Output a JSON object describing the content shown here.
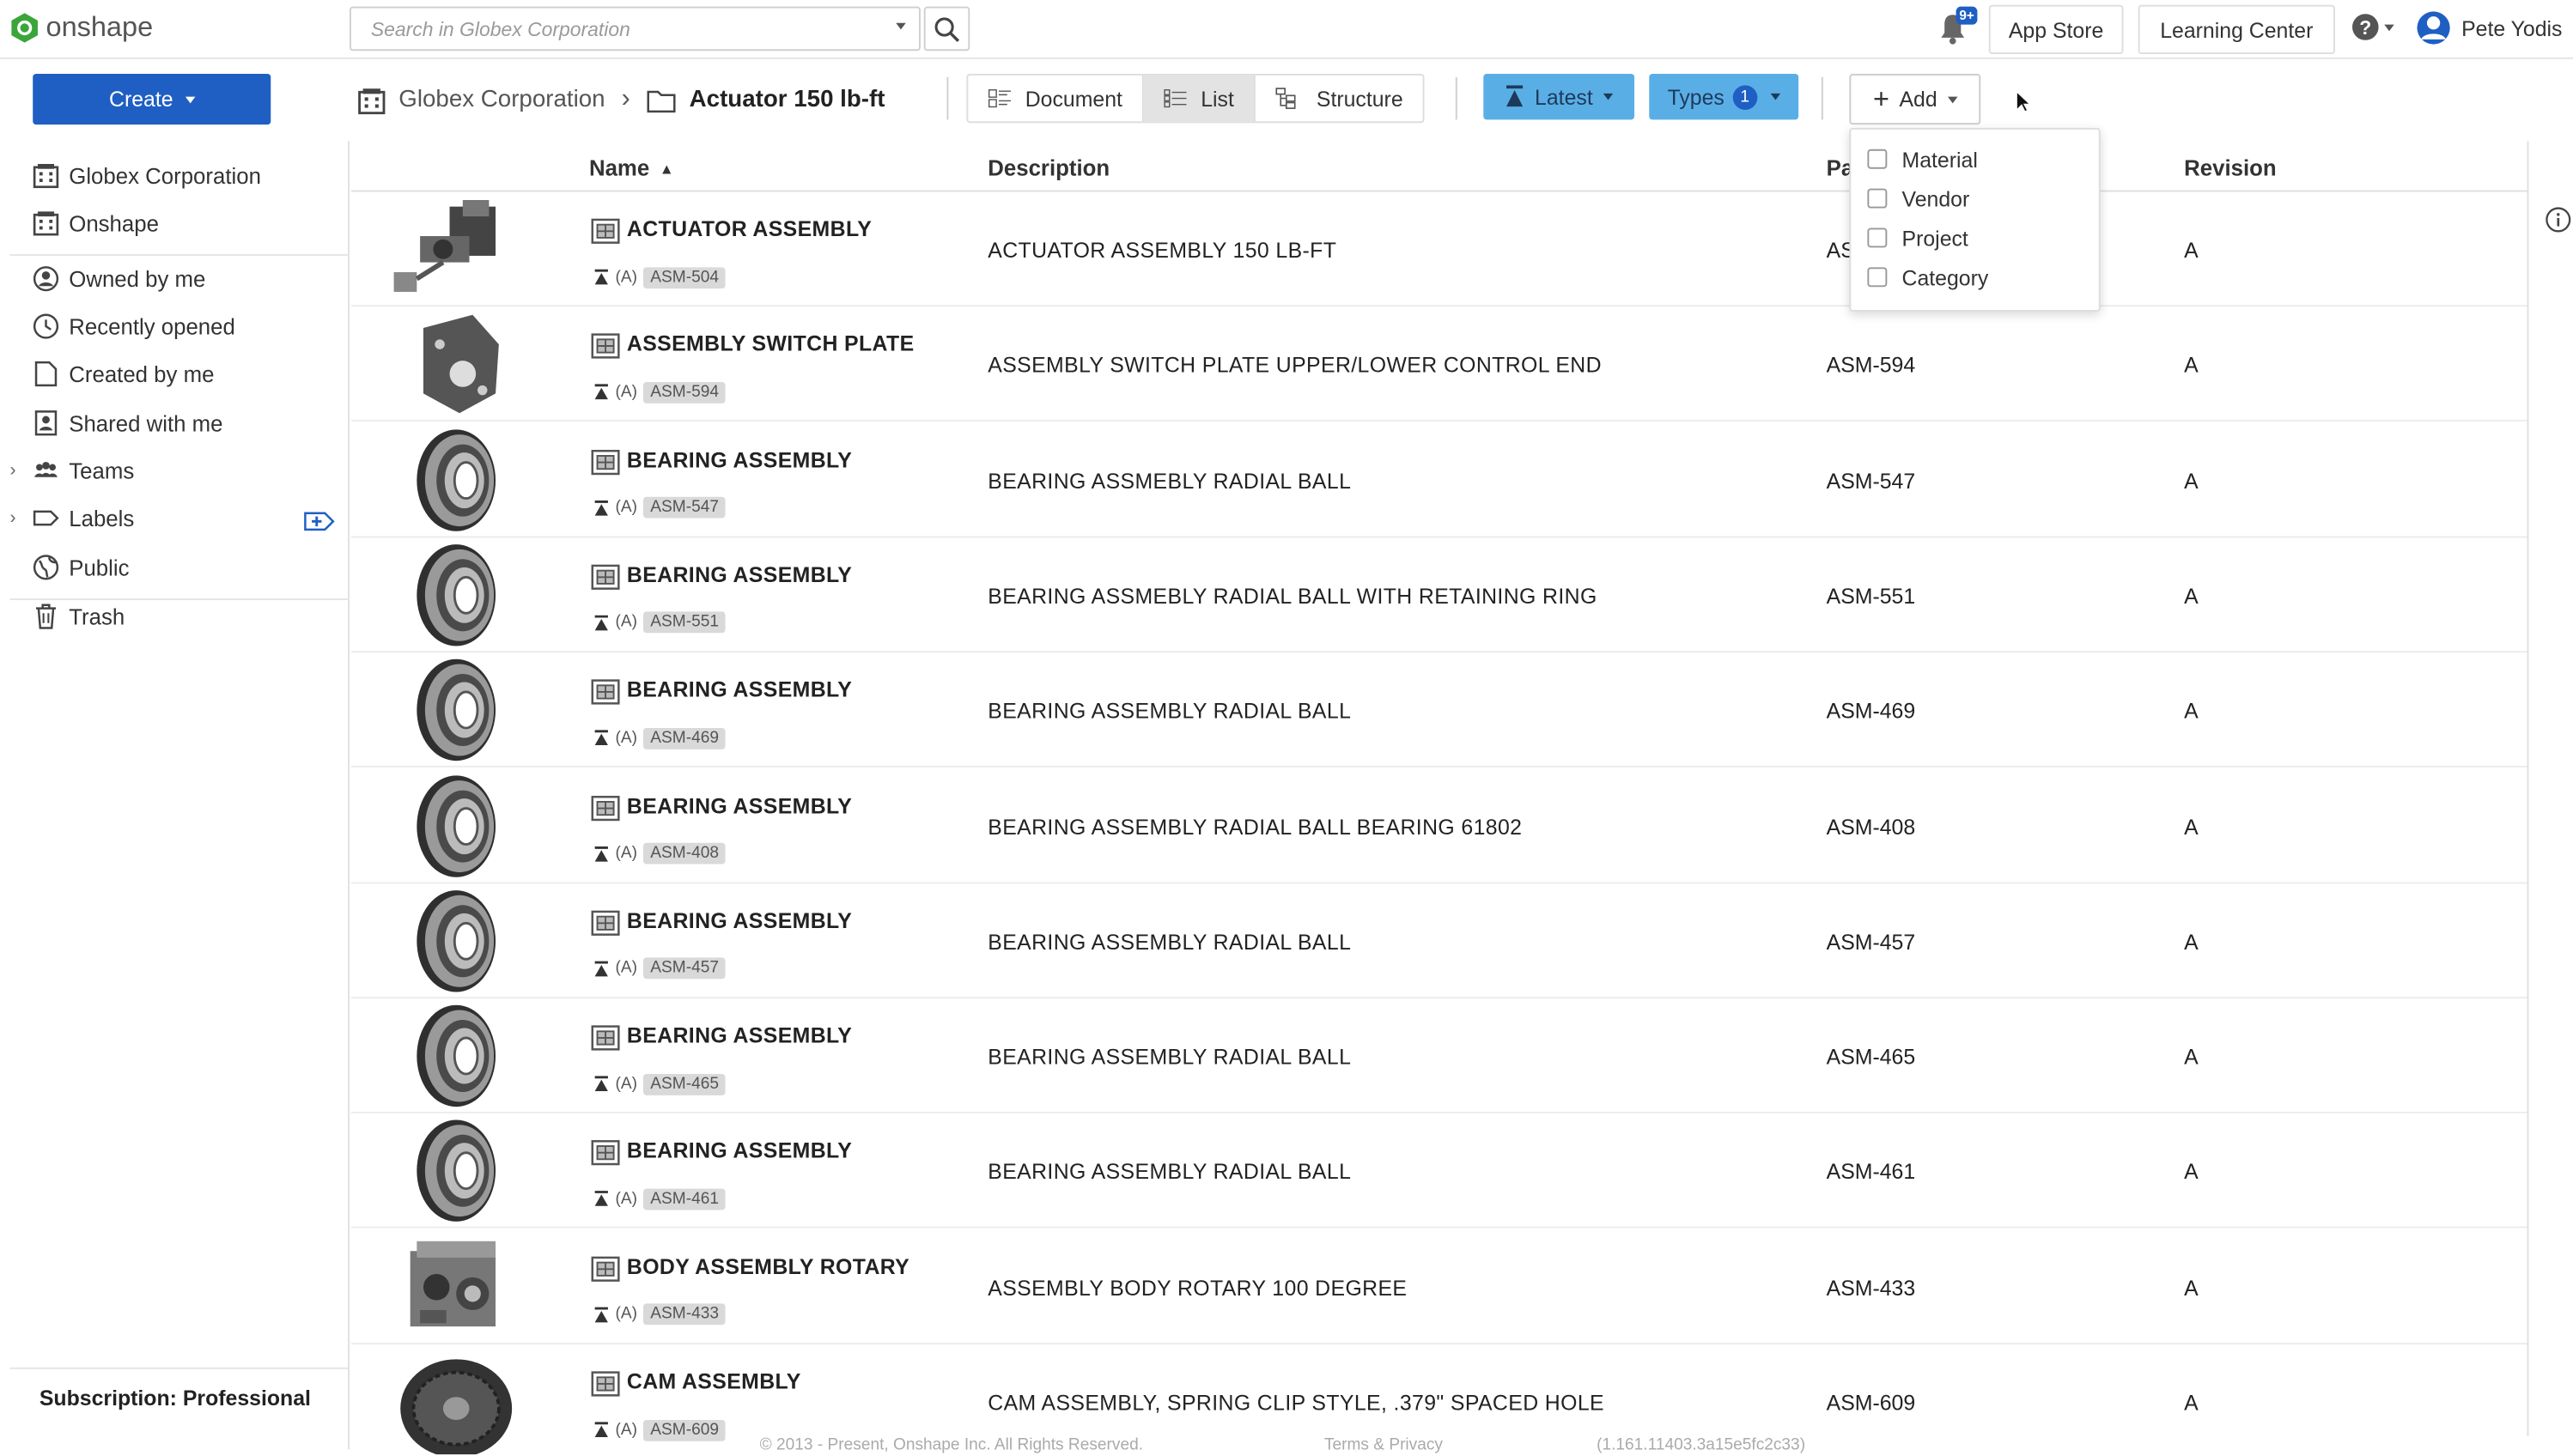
{
  "app": {
    "name": "onshape"
  },
  "search": {
    "placeholder": "Search in Globex Corporation"
  },
  "notifications": {
    "badge": "9+"
  },
  "top": {
    "app_store": "App Store",
    "learning_center": "Learning Center",
    "user": "Pete Yodis"
  },
  "create": {
    "label": "Create"
  },
  "sidebar": {
    "items": [
      {
        "label": "Globex Corporation",
        "icon": "building-icon"
      },
      {
        "label": "Onshape",
        "icon": "building-icon"
      },
      {
        "label": "Owned by me",
        "icon": "person-icon"
      },
      {
        "label": "Recently opened",
        "icon": "clock-icon"
      },
      {
        "label": "Created by me",
        "icon": "document-icon"
      },
      {
        "label": "Shared with me",
        "icon": "shared-icon"
      },
      {
        "label": "Teams",
        "icon": "team-icon"
      },
      {
        "label": "Labels",
        "icon": "label-icon"
      },
      {
        "label": "Public",
        "icon": "globe-icon"
      },
      {
        "label": "Trash",
        "icon": "trash-icon"
      }
    ],
    "subscription": "Subscription: Professional"
  },
  "breadcrumb": {
    "org": "Globex Corporation",
    "folder": "Actuator 150 lb-ft"
  },
  "views": {
    "document": "Document",
    "list": "List",
    "structure": "Structure"
  },
  "filters": {
    "latest": "Latest",
    "types": "Types",
    "types_count": "1",
    "add": "Add"
  },
  "add_menu": {
    "items": [
      "Material",
      "Vendor",
      "Project",
      "Category"
    ]
  },
  "table": {
    "columns": {
      "name": "Name",
      "description": "Description",
      "part_number": "Pa",
      "revision": "Revision"
    },
    "rows": [
      {
        "name": "ACTUATOR ASSEMBLY",
        "ver": "(A)",
        "tag": "ASM-504",
        "desc": "ACTUATOR ASSEMBLY 150 LB-FT",
        "pn": "AS",
        "rev": "A",
        "thumb": "actuator"
      },
      {
        "name": "ASSEMBLY SWITCH PLATE",
        "ver": "(A)",
        "tag": "ASM-594",
        "desc": "ASSEMBLY SWITCH PLATE UPPER/LOWER CONTROL END",
        "pn": "ASM-594",
        "rev": "A",
        "thumb": "plate"
      },
      {
        "name": "BEARING ASSEMBLY",
        "ver": "(A)",
        "tag": "ASM-547",
        "desc": "BEARING ASSMEBLY RADIAL BALL",
        "pn": "ASM-547",
        "rev": "A",
        "thumb": "bearing"
      },
      {
        "name": "BEARING ASSEMBLY",
        "ver": "(A)",
        "tag": "ASM-551",
        "desc": "BEARING ASSMEBLY RADIAL BALL WITH RETAINING RING",
        "pn": "ASM-551",
        "rev": "A",
        "thumb": "bearing"
      },
      {
        "name": "BEARING ASSEMBLY",
        "ver": "(A)",
        "tag": "ASM-469",
        "desc": "BEARING ASSEMBLY RADIAL BALL",
        "pn": "ASM-469",
        "rev": "A",
        "thumb": "bearing"
      },
      {
        "name": "BEARING ASSEMBLY",
        "ver": "(A)",
        "tag": "ASM-408",
        "desc": "BEARING ASSEMBLY RADIAL BALL BEARING 61802",
        "pn": "ASM-408",
        "rev": "A",
        "thumb": "bearing"
      },
      {
        "name": "BEARING ASSEMBLY",
        "ver": "(A)",
        "tag": "ASM-457",
        "desc": "BEARING ASSEMBLY RADIAL BALL",
        "pn": "ASM-457",
        "rev": "A",
        "thumb": "bearing"
      },
      {
        "name": "BEARING ASSEMBLY",
        "ver": "(A)",
        "tag": "ASM-465",
        "desc": "BEARING ASSEMBLY RADIAL BALL",
        "pn": "ASM-465",
        "rev": "A",
        "thumb": "bearing"
      },
      {
        "name": "BEARING ASSEMBLY",
        "ver": "(A)",
        "tag": "ASM-461",
        "desc": "BEARING ASSEMBLY RADIAL BALL",
        "pn": "ASM-461",
        "rev": "A",
        "thumb": "bearing"
      },
      {
        "name": "BODY ASSEMBLY ROTARY",
        "ver": "(A)",
        "tag": "ASM-433",
        "desc": "ASSEMBLY BODY ROTARY 100 DEGREE",
        "pn": "ASM-433",
        "rev": "A",
        "thumb": "body"
      },
      {
        "name": "CAM ASSEMBLY",
        "ver": "(A)",
        "tag": "ASM-609",
        "desc": "CAM ASSEMBLY, SPRING CLIP STYLE, .379\" SPACED HOLE",
        "pn": "ASM-609",
        "rev": "A",
        "thumb": "cam"
      }
    ]
  },
  "footer": {
    "copyright": "© 2013 - Present, Onshape Inc. All Rights Reserved.",
    "terms": "Terms & Privacy",
    "version": "(1.161.11403.3a15e5fc2c33)"
  },
  "colors": {
    "accent": "#1f5fc4",
    "filter": "#5aaee6"
  }
}
